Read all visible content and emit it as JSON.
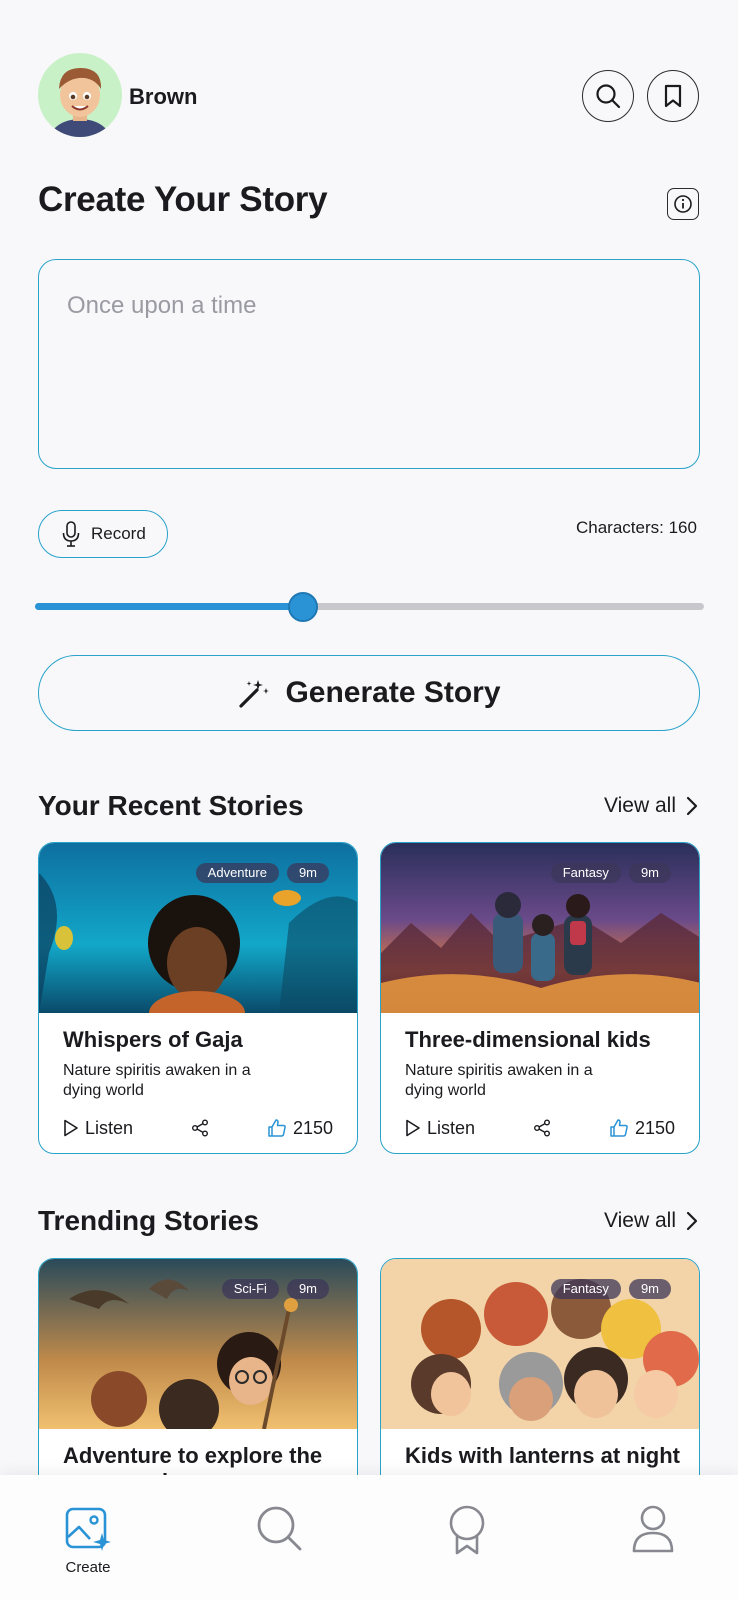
{
  "header": {
    "username": "Brown"
  },
  "create": {
    "title": "Create Your Story",
    "placeholder": "Once upon a time",
    "record_label": "Record",
    "characters_label": "Characters: 160",
    "slider_value": 0.4,
    "generate_label": "Generate Story"
  },
  "recent": {
    "title": "Your Recent Stories",
    "view_all": "View all",
    "cards": [
      {
        "genre": "Adventure",
        "duration": "9m",
        "title": "Whispers of Gaja",
        "description": "Nature spiritis awaken in a dying world",
        "listen": "Listen",
        "likes": "2150"
      },
      {
        "genre": "Fantasy",
        "duration": "9m",
        "title": "Three-dimensional kids",
        "description": "Nature spiritis awaken in a dying world",
        "listen": "Listen",
        "likes": "2150"
      }
    ]
  },
  "trending": {
    "title": "Trending Stories",
    "view_all": "View all",
    "cards": [
      {
        "genre": "Sci-Fi",
        "duration": "9m",
        "title": "Adventure to explore the moon and space"
      },
      {
        "genre": "Fantasy",
        "duration": "9m",
        "title": "Kids with lanterns at night"
      }
    ]
  },
  "nav": {
    "create_label": "Create"
  },
  "colors": {
    "accent": "#2aa3c9",
    "slider": "#2a93d5",
    "background": "#f8f8fb"
  }
}
